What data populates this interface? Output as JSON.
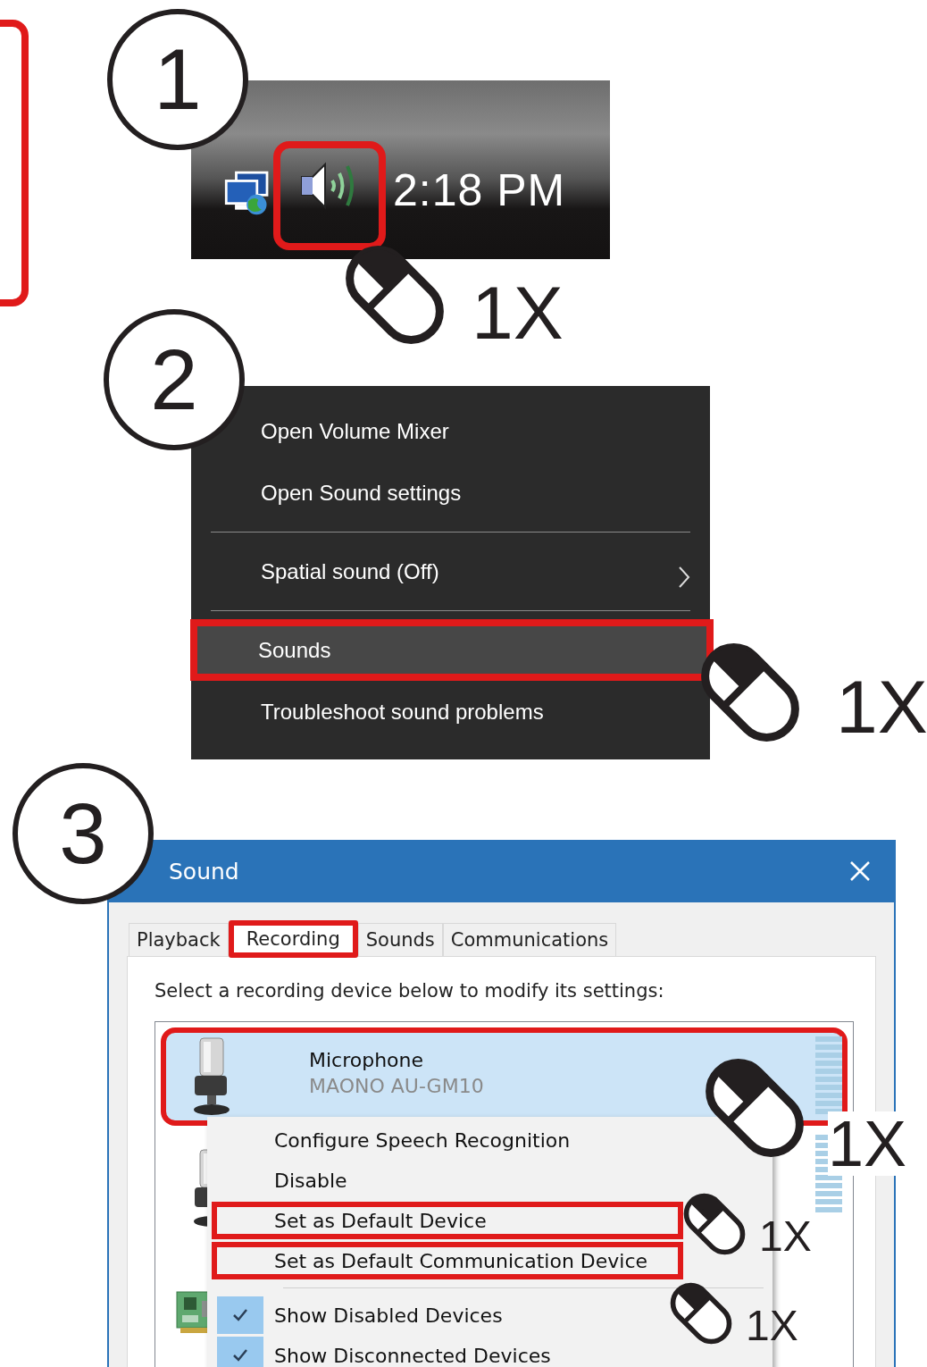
{
  "steps": [
    {
      "kind": "taskbar",
      "number": "1",
      "clock": "2:18 PM",
      "speaker_highlighted": true,
      "click": "1X"
    },
    {
      "kind": "menu",
      "number": "2",
      "items": [
        {
          "kind": "item",
          "label": "Open Volume Mixer",
          "highlighted": false,
          "submenu": false
        },
        {
          "kind": "item",
          "label": "Open Sound settings",
          "highlighted": false,
          "submenu": false
        },
        {
          "kind": "separator"
        },
        {
          "kind": "item",
          "label": "Spatial sound (Off)",
          "highlighted": false,
          "submenu": true
        },
        {
          "kind": "separator"
        },
        {
          "kind": "item",
          "label": "Sounds",
          "highlighted": true,
          "submenu": false,
          "click": "1X"
        },
        {
          "kind": "item",
          "label": "Troubleshoot sound problems",
          "highlighted": false,
          "submenu": false
        }
      ]
    },
    {
      "kind": "dialog",
      "number": "3",
      "title": "Sound",
      "tabs": [
        {
          "label": "Playback",
          "selected": false,
          "highlighted": false
        },
        {
          "label": "Recording",
          "selected": true,
          "highlighted": true
        },
        {
          "label": "Sounds",
          "selected": false,
          "highlighted": false
        },
        {
          "label": "Communications",
          "selected": false,
          "highlighted": false
        }
      ],
      "instruction": "Select a recording device below to modify its settings:",
      "devices": [
        {
          "kind": "microphone",
          "name": "Microphone",
          "model": "MAONO AU-GM10",
          "selected": true,
          "highlighted": true,
          "click": "1X"
        },
        {
          "kind": "microphone",
          "selected": false,
          "highlighted": false
        },
        {
          "kind": "card",
          "selected": false,
          "highlighted": false
        }
      ],
      "context_menu": [
        {
          "kind": "item",
          "label": "Configure Speech Recognition",
          "highlighted": false,
          "checked": false
        },
        {
          "kind": "item",
          "label": "Disable",
          "highlighted": false,
          "checked": false
        },
        {
          "kind": "item",
          "label": "Set as Default Device",
          "highlighted": true,
          "checked": false,
          "click": "1X"
        },
        {
          "kind": "item",
          "label": "Set as Default Communication Device",
          "highlighted": true,
          "checked": false,
          "click": "1X"
        },
        {
          "kind": "separator"
        },
        {
          "kind": "item",
          "label": "Show Disabled Devices",
          "highlighted": false,
          "checked": true
        },
        {
          "kind": "item",
          "label": "Show Disconnected Devices",
          "highlighted": false,
          "checked": true
        }
      ]
    }
  ]
}
